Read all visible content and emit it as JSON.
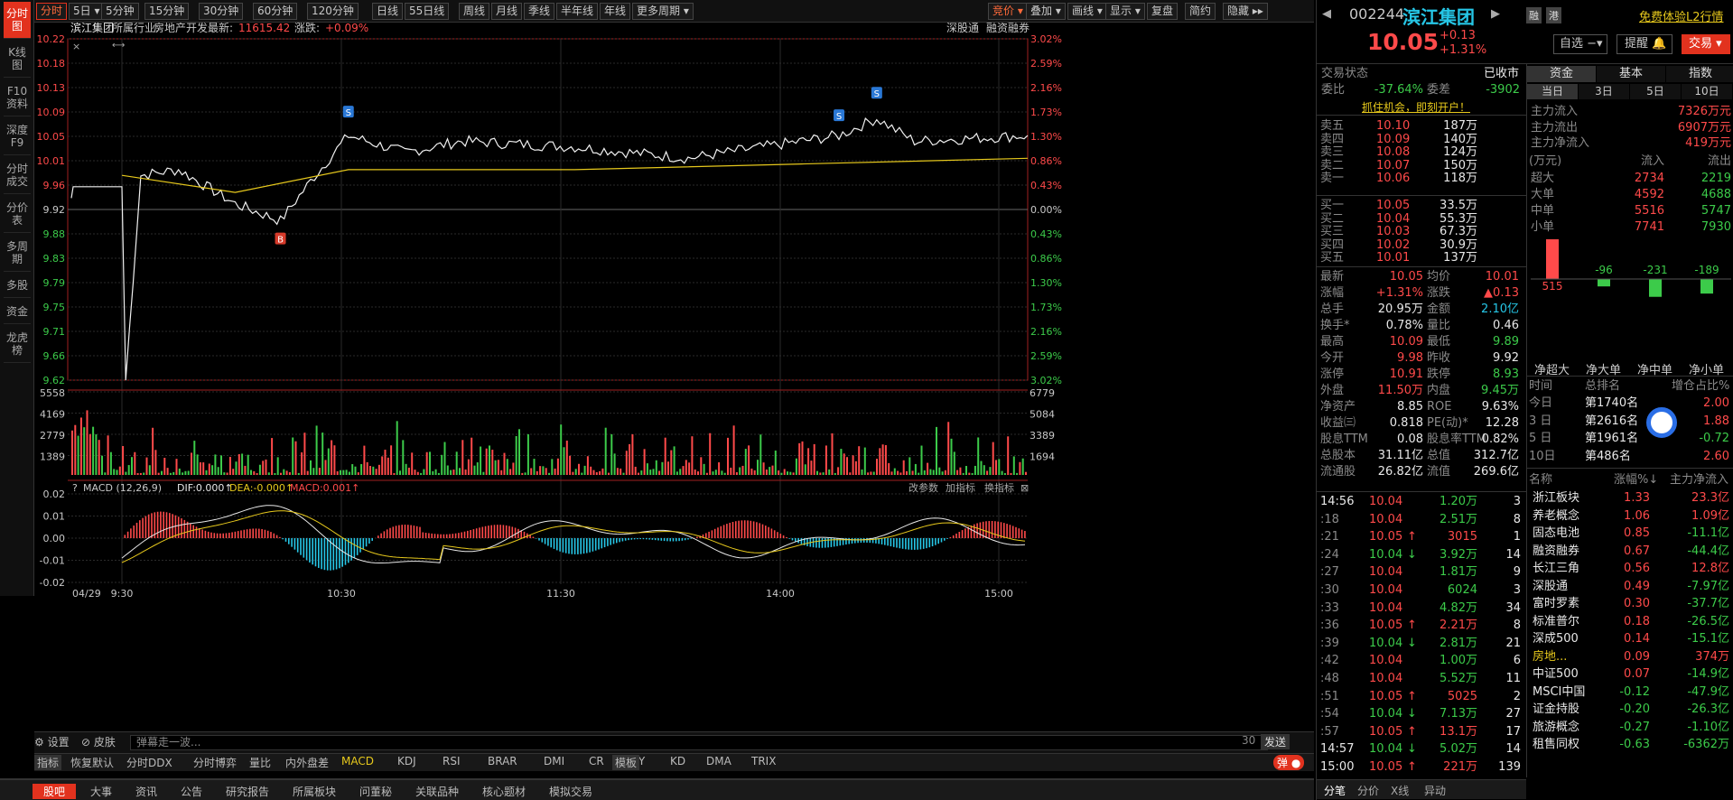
{
  "vtabs": [
    "分时图",
    "K线图",
    "F10资料",
    "深度F9",
    "分时成交",
    "分价表",
    "多周期",
    "多股",
    "资金",
    "龙虎榜"
  ],
  "toolbar": {
    "left": [
      "分时",
      "5日",
      "5分钟",
      "15分钟",
      "30分钟",
      "60分钟",
      "120分钟",
      "日线",
      "55日线",
      "周线",
      "月线",
      "季线",
      "半年线",
      "年线",
      "更多周期"
    ],
    "right": [
      "竞价",
      "叠加",
      "画线",
      "显示",
      "复盘",
      "简约",
      "隐藏"
    ]
  },
  "info": {
    "name": "滨江集团",
    "industry_label": "所属行业:",
    "industry": "房地产开发",
    "latest_label": "最新:",
    "latest": "11615.42",
    "chg_label": "涨跌:",
    "chg": "+0.09%",
    "link1": "深股通",
    "link2": "融资融券"
  },
  "price_axis": [
    "10.22",
    "10.18",
    "10.13",
    "10.09",
    "10.05",
    "10.01",
    "9.96",
    "9.92",
    "9.88",
    "9.83",
    "9.79",
    "9.75",
    "9.71",
    "9.66",
    "9.62"
  ],
  "pct_axis": [
    "3.02%",
    "2.59%",
    "2.16%",
    "1.73%",
    "1.30%",
    "0.86%",
    "0.43%",
    "0.00%",
    "0.43%",
    "0.86%",
    "1.30%",
    "1.73%",
    "2.16%",
    "2.59%",
    "3.02%"
  ],
  "vol_axis_left": [
    "5558",
    "4169",
    "2779",
    "1389"
  ],
  "vol_axis_right": [
    "6779",
    "5084",
    "3389",
    "1694"
  ],
  "macd": {
    "label": "MACD (12,26,9)",
    "dif": "DIF:0.000↑",
    "dea": "DEA:-0.000↑",
    "macd": "MACD:0.001↑",
    "btn1": "改参数",
    "btn2": "加指标",
    "btn3": "换指标",
    "axis": [
      "0.02",
      "0.01",
      "0.00",
      "-0.01",
      "-0.02"
    ]
  },
  "time_axis": [
    "04/29",
    "9:30",
    "10:30",
    "11:30",
    "14:00",
    "15:00"
  ],
  "markers": [
    "S",
    "B",
    "S",
    "S"
  ],
  "chart_data": {
    "type": "line",
    "title": "滨江集团",
    "ylim": [
      9.62,
      10.22
    ],
    "prev_close": 9.92,
    "price": [
      {
        "t": "9:30",
        "p": 9.96
      },
      {
        "t": "9:31",
        "p": 9.62
      },
      {
        "t": "9:35",
        "p": 9.98
      },
      {
        "t": "9:45",
        "p": 9.99
      },
      {
        "t": "10:00",
        "p": 9.93
      },
      {
        "t": "10:12",
        "p": 9.9
      },
      {
        "t": "10:20",
        "p": 9.97
      },
      {
        "t": "10:30",
        "p": 10.05
      },
      {
        "t": "10:45",
        "p": 10.02
      },
      {
        "t": "11:00",
        "p": 10.04
      },
      {
        "t": "11:30",
        "p": 10.03
      },
      {
        "t": "13:30",
        "p": 10.01
      },
      {
        "t": "14:10",
        "p": 10.05
      },
      {
        "t": "14:20",
        "p": 10.08
      },
      {
        "t": "14:30",
        "p": 10.04
      },
      {
        "t": "15:00",
        "p": 10.05
      }
    ],
    "avg": [
      {
        "t": "9:30",
        "p": 9.98
      },
      {
        "t": "10:00",
        "p": 9.95
      },
      {
        "t": "10:30",
        "p": 9.99
      },
      {
        "t": "11:30",
        "p": 9.99
      },
      {
        "t": "14:00",
        "p": 10.0
      },
      {
        "t": "15:00",
        "p": 10.01
      }
    ]
  },
  "input": {
    "settings": "设置",
    "skin": "皮肤",
    "placeholder": "弹幕走一波...",
    "count": "30",
    "send": "发送"
  },
  "indicators": [
    "指标",
    "恢复默认",
    "分时DDX",
    "分时博弈",
    "量比",
    "内外盘差",
    "MACD",
    "KDJ",
    "RSI",
    "BRAR",
    "DMI",
    "CR",
    "PSY",
    "KD",
    "DMA",
    "TRIX",
    "模板"
  ],
  "bottomtabs": [
    "股吧",
    "大事",
    "资讯",
    "公告",
    "研究报告",
    "所属板块",
    "问董秘",
    "关联品种",
    "核心题材",
    "模拟交易"
  ],
  "stock": {
    "code": "002244",
    "name": "滨江集团",
    "price": "10.05",
    "chg": "+0.13",
    "pct": "+1.31%",
    "tag1": "融",
    "tag2": "港",
    "l2": "免费体验L2行情",
    "btn1": "自选",
    "btn2": "提醒",
    "btn3": "交易"
  },
  "status": {
    "label": "交易状态",
    "value": "已收市",
    "wb_label": "委比",
    "wb": "-37.64%",
    "wc_label": "委差",
    "wc": "-3902",
    "promo": "抓住机会，即刻开户！"
  },
  "asks": [
    [
      "卖五",
      "10.10",
      "187万"
    ],
    [
      "卖四",
      "10.09",
      "140万"
    ],
    [
      "卖三",
      "10.08",
      "124万"
    ],
    [
      "卖二",
      "10.07",
      "150万"
    ],
    [
      "卖一",
      "10.06",
      "118万"
    ]
  ],
  "bids": [
    [
      "买一",
      "10.05",
      "33.5万"
    ],
    [
      "买二",
      "10.04",
      "55.3万"
    ],
    [
      "买三",
      "10.03",
      "67.3万"
    ],
    [
      "买四",
      "10.02",
      "30.9万"
    ],
    [
      "买五",
      "10.01",
      "137万"
    ]
  ],
  "quote": [
    [
      "最新",
      "10.05",
      "均价",
      "10.01"
    ],
    [
      "涨幅",
      "+1.31%",
      "涨跌",
      "▲0.13"
    ],
    [
      "总手",
      "20.95万",
      "金额",
      "2.10亿"
    ],
    [
      "换手*",
      "0.78%",
      "量比",
      "0.46"
    ],
    [
      "最高",
      "10.09",
      "最低",
      "9.89"
    ],
    [
      "今开",
      "9.98",
      "昨收",
      "9.92"
    ],
    [
      "涨停",
      "10.91",
      "跌停",
      "8.93"
    ],
    [
      "外盘",
      "11.50万",
      "内盘",
      "9.45万"
    ],
    [
      "净资产",
      "8.85",
      "ROE",
      "9.63%"
    ],
    [
      "收益㈢",
      "0.818",
      "PE(动)*",
      "12.28"
    ],
    [
      "股息TTM",
      "0.08",
      "股息率TTM",
      "0.82%"
    ],
    [
      "总股本",
      "31.11亿",
      "总值",
      "312.7亿"
    ],
    [
      "流通股",
      "26.82亿",
      "流值",
      "269.6亿"
    ]
  ],
  "trades": [
    [
      "14:56",
      "10.04",
      "",
      "1.20万",
      "3"
    ],
    [
      ":18",
      "10.04",
      "",
      "2.51万",
      "8"
    ],
    [
      ":21",
      "10.05",
      "↑",
      "3015",
      "1"
    ],
    [
      ":24",
      "10.04",
      "↓",
      "3.92万",
      "14"
    ],
    [
      ":27",
      "10.04",
      "",
      "1.81万",
      "9"
    ],
    [
      ":30",
      "10.04",
      "",
      "6024",
      "3"
    ],
    [
      ":33",
      "10.04",
      "",
      "4.82万",
      "34"
    ],
    [
      ":36",
      "10.05",
      "↑",
      "2.21万",
      "8"
    ],
    [
      ":39",
      "10.04",
      "↓",
      "2.81万",
      "21"
    ],
    [
      ":42",
      "10.04",
      "",
      "1.00万",
      "6"
    ],
    [
      ":48",
      "10.04",
      "",
      "5.52万",
      "11"
    ],
    [
      ":51",
      "10.05",
      "↑",
      "5025",
      "2"
    ],
    [
      ":54",
      "10.04",
      "↓",
      "7.13万",
      "27"
    ],
    [
      ":57",
      "10.05",
      "↑",
      "13.1万",
      "17"
    ],
    [
      "14:57",
      "10.04",
      "↓",
      "5.02万",
      "14"
    ],
    [
      "15:00",
      "10.05",
      "↑",
      "221万",
      "139"
    ]
  ],
  "tradetabs": [
    "分笔",
    "分价",
    "X线",
    "异动"
  ],
  "fund": {
    "tabs": [
      "资金",
      "基本",
      "指数"
    ],
    "subtabs": [
      "当日",
      "3日",
      "5日",
      "10日"
    ],
    "rows": [
      [
        "主力流入",
        "7326万元"
      ],
      [
        "主力流出",
        "6907万元"
      ],
      [
        "主力净流入",
        "419万元"
      ]
    ],
    "head": [
      "(万元)",
      "流入",
      "流出"
    ],
    "table": [
      [
        "超大",
        "2734",
        "2219"
      ],
      [
        "大单",
        "4592",
        "4688"
      ],
      [
        "中单",
        "5516",
        "5747"
      ],
      [
        "小单",
        "7741",
        "7930"
      ]
    ],
    "net": [
      515,
      -96,
      -231,
      -189
    ],
    "netlabels": [
      "净超大",
      "净大单",
      "净中单",
      "净小单"
    ]
  },
  "rank": {
    "head": [
      "时间",
      "总排名",
      "增仓占比%"
    ],
    "rows": [
      [
        "今日",
        "第1740名",
        "2.00"
      ],
      [
        "3 日",
        "第2616名",
        "1.88"
      ],
      [
        "5 日",
        "第1961名",
        "-0.72"
      ],
      [
        "10日",
        "第486名",
        "2.60"
      ]
    ]
  },
  "sectors": {
    "head": [
      "名称",
      "涨幅%↓",
      "主力净流入"
    ],
    "rows": [
      [
        "浙江板块",
        "1.33",
        "23.3亿"
      ],
      [
        "养老概念",
        "1.06",
        "1.09亿"
      ],
      [
        "固态电池",
        "0.85",
        "-11.1亿"
      ],
      [
        "融资融券",
        "0.67",
        "-44.4亿"
      ],
      [
        "长江三角",
        "0.56",
        "12.8亿"
      ],
      [
        "深股通",
        "0.49",
        "-7.97亿"
      ],
      [
        "富时罗素",
        "0.30",
        "-37.7亿"
      ],
      [
        "标准普尔",
        "0.18",
        "-26.5亿"
      ],
      [
        "深成500",
        "0.14",
        "-15.1亿"
      ],
      [
        "房地...",
        "0.09",
        "374万"
      ],
      [
        "中证500",
        "0.07",
        "-14.9亿"
      ],
      [
        "MSCI中国",
        "-0.12",
        "-47.9亿"
      ],
      [
        "证金持股",
        "-0.20",
        "-26.3亿"
      ],
      [
        "旅游概念",
        "-0.27",
        "-1.10亿"
      ],
      [
        "租售同权",
        "-0.63",
        "-6362万"
      ]
    ]
  }
}
